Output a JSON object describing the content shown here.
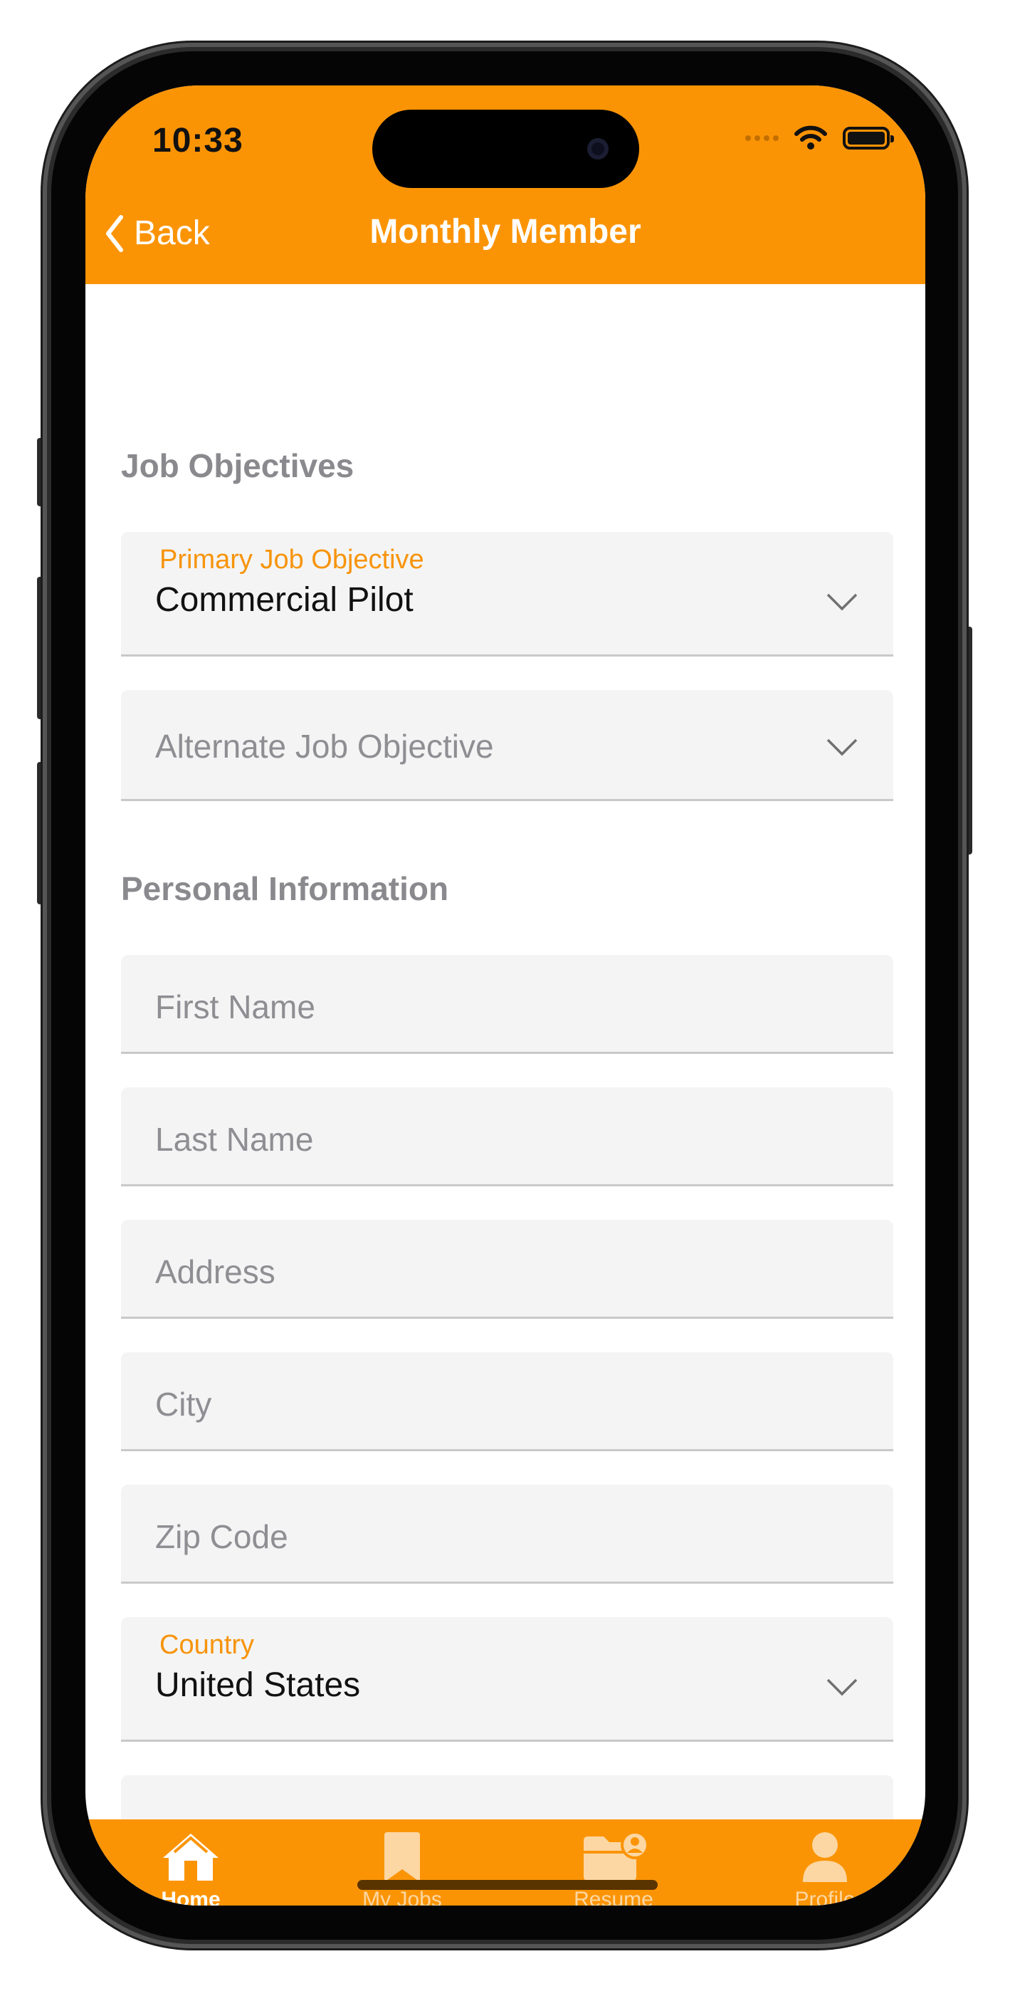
{
  "status_bar": {
    "time": "10:33"
  },
  "nav": {
    "back_label": "Back",
    "title": "Monthly Member"
  },
  "sections": {
    "job_objectives": "Job Objectives",
    "personal_information": "Personal Information"
  },
  "fields": {
    "primary_job_objective": {
      "label": "Primary Job Objective",
      "value": "Commercial Pilot"
    },
    "alternate_job_objective": {
      "placeholder": "Alternate Job Objective"
    },
    "first_name": {
      "placeholder": "First Name"
    },
    "last_name": {
      "placeholder": "Last Name"
    },
    "address": {
      "placeholder": "Address"
    },
    "city": {
      "placeholder": "City"
    },
    "zip_code": {
      "placeholder": "Zip Code"
    },
    "country": {
      "label": "Country",
      "value": "United States"
    }
  },
  "tabs": [
    {
      "label": "Home",
      "icon": "home-icon",
      "active": true
    },
    {
      "label": "My Jobs",
      "icon": "bookmark-icon",
      "active": false
    },
    {
      "label": "Resume",
      "icon": "folder-user-icon",
      "active": false
    },
    {
      "label": "Profile",
      "icon": "person-icon",
      "active": false
    }
  ],
  "colors": {
    "accent": "#fb9405",
    "label_orange": "#f7940c",
    "field_background": "#f4f4f4",
    "section_title": "#8a8a8e",
    "tab_inactive": "#fcd7a3"
  }
}
